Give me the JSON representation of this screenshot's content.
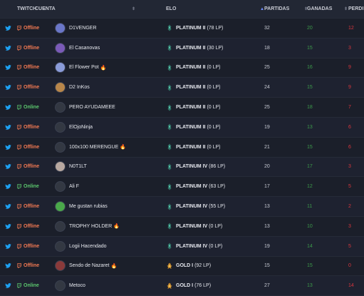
{
  "header": {
    "twitch": "TWITCH",
    "cuenta": "CUENTA",
    "elo": "ELO",
    "partidas": "PARTIDAS",
    "ganadas": "GANADAS",
    "perdidas": "PERDI"
  },
  "colors": {
    "offline": "#f47a52",
    "online": "#5cc86e",
    "won": "#3c9a4a",
    "lost": "#d9363e",
    "twitter": "#1da1f2",
    "platinum": "#3bb39a",
    "gold": "#c88a2c"
  },
  "rows": [
    {
      "status": "Offline",
      "account": "D1VENGER",
      "fire": false,
      "tier": "platinum",
      "elo": "PLATINUM II",
      "lp": "(78 LP)",
      "partidas": "32",
      "ganadas": "20",
      "perdidas": "12",
      "avatar": "#6a76c8"
    },
    {
      "status": "Offline",
      "account": "El Casanovas",
      "fire": false,
      "tier": "platinum",
      "elo": "PLATINUM II",
      "lp": "(30 LP)",
      "partidas": "18",
      "ganadas": "15",
      "perdidas": "3",
      "avatar": "#7a5ab8"
    },
    {
      "status": "Offline",
      "account": "El Flower Pot",
      "fire": true,
      "tier": "platinum",
      "elo": "PLATINUM II",
      "lp": "(0 LP)",
      "partidas": "25",
      "ganadas": "16",
      "perdidas": "9",
      "avatar": "#8a9bd8"
    },
    {
      "status": "Offline",
      "account": "D2 InKos",
      "fire": false,
      "tier": "platinum",
      "elo": "PLATINUM II",
      "lp": "(0 LP)",
      "partidas": "24",
      "ganadas": "15",
      "perdidas": "9",
      "avatar": "#b8864a"
    },
    {
      "status": "Online",
      "account": "PERO AYUDAMEEE",
      "fire": false,
      "tier": "platinum",
      "elo": "PLATINUM II",
      "lp": "(0 LP)",
      "partidas": "25",
      "ganadas": "18",
      "perdidas": "7",
      "avatar": "#333842"
    },
    {
      "status": "Offline",
      "account": "ElOjoNinja",
      "fire": false,
      "tier": "platinum",
      "elo": "PLATINUM II",
      "lp": "(0 LP)",
      "partidas": "19",
      "ganadas": "13",
      "perdidas": "6",
      "avatar": "#333842"
    },
    {
      "status": "Offline",
      "account": "100x100 MERENGUE",
      "fire": true,
      "tier": "platinum",
      "elo": "PLATINUM II",
      "lp": "(0 LP)",
      "partidas": "21",
      "ganadas": "15",
      "perdidas": "6",
      "avatar": "#333842"
    },
    {
      "status": "Offline",
      "account": "N0T1LT",
      "fire": false,
      "tier": "platinum",
      "elo": "PLATINUM IV",
      "lp": "(86 LP)",
      "partidas": "20",
      "ganadas": "17",
      "perdidas": "3",
      "avatar": "#b8a8a0"
    },
    {
      "status": "Online",
      "account": "Ali F",
      "fire": false,
      "tier": "platinum",
      "elo": "PLATINUM IV",
      "lp": "(63 LP)",
      "partidas": "17",
      "ganadas": "12",
      "perdidas": "5",
      "avatar": "#333842"
    },
    {
      "status": "Offline",
      "account": "Me gustan rubias",
      "fire": false,
      "tier": "platinum",
      "elo": "PLATINUM IV",
      "lp": "(55 LP)",
      "partidas": "13",
      "ganadas": "11",
      "perdidas": "2",
      "avatar": "#4aa84a"
    },
    {
      "status": "Offline",
      "account": "TROPHY HOLDER",
      "fire": true,
      "tier": "platinum",
      "elo": "PLATINUM IV",
      "lp": "(0 LP)",
      "partidas": "13",
      "ganadas": "10",
      "perdidas": "3",
      "avatar": "#333842"
    },
    {
      "status": "Offline",
      "account": "Logii Hacendado",
      "fire": false,
      "tier": "platinum",
      "elo": "PLATINUM IV",
      "lp": "(0 LP)",
      "partidas": "19",
      "ganadas": "14",
      "perdidas": "5",
      "avatar": "#333842"
    },
    {
      "status": "Offline",
      "account": "Sendo de Nazaret",
      "fire": true,
      "tier": "gold",
      "elo": "GOLD I",
      "lp": "(92 LP)",
      "partidas": "15",
      "ganadas": "15",
      "perdidas": "0",
      "avatar": "#8a3a3a"
    },
    {
      "status": "Online",
      "account": "Metoco",
      "fire": false,
      "tier": "gold",
      "elo": "GOLD I",
      "lp": "(76 LP)",
      "partidas": "27",
      "ganadas": "13",
      "perdidas": "14",
      "avatar": "#333842"
    }
  ]
}
